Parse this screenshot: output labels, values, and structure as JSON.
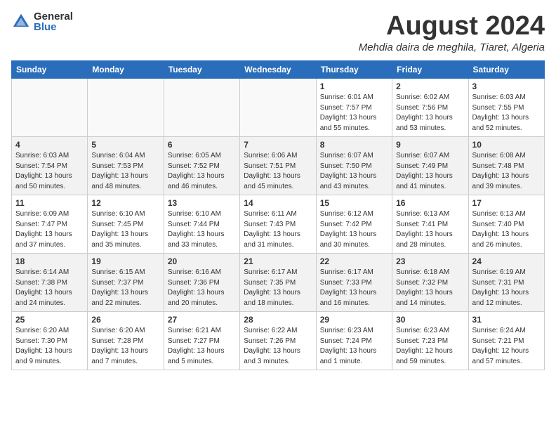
{
  "header": {
    "logo_general": "General",
    "logo_blue": "Blue",
    "month_title": "August 2024",
    "location": "Mehdia daira de meghila, Tiaret, Algeria"
  },
  "weekdays": [
    "Sunday",
    "Monday",
    "Tuesday",
    "Wednesday",
    "Thursday",
    "Friday",
    "Saturday"
  ],
  "weeks": [
    [
      {
        "day": "",
        "info": ""
      },
      {
        "day": "",
        "info": ""
      },
      {
        "day": "",
        "info": ""
      },
      {
        "day": "",
        "info": ""
      },
      {
        "day": "1",
        "info": "Sunrise: 6:01 AM\nSunset: 7:57 PM\nDaylight: 13 hours\nand 55 minutes."
      },
      {
        "day": "2",
        "info": "Sunrise: 6:02 AM\nSunset: 7:56 PM\nDaylight: 13 hours\nand 53 minutes."
      },
      {
        "day": "3",
        "info": "Sunrise: 6:03 AM\nSunset: 7:55 PM\nDaylight: 13 hours\nand 52 minutes."
      }
    ],
    [
      {
        "day": "4",
        "info": "Sunrise: 6:03 AM\nSunset: 7:54 PM\nDaylight: 13 hours\nand 50 minutes."
      },
      {
        "day": "5",
        "info": "Sunrise: 6:04 AM\nSunset: 7:53 PM\nDaylight: 13 hours\nand 48 minutes."
      },
      {
        "day": "6",
        "info": "Sunrise: 6:05 AM\nSunset: 7:52 PM\nDaylight: 13 hours\nand 46 minutes."
      },
      {
        "day": "7",
        "info": "Sunrise: 6:06 AM\nSunset: 7:51 PM\nDaylight: 13 hours\nand 45 minutes."
      },
      {
        "day": "8",
        "info": "Sunrise: 6:07 AM\nSunset: 7:50 PM\nDaylight: 13 hours\nand 43 minutes."
      },
      {
        "day": "9",
        "info": "Sunrise: 6:07 AM\nSunset: 7:49 PM\nDaylight: 13 hours\nand 41 minutes."
      },
      {
        "day": "10",
        "info": "Sunrise: 6:08 AM\nSunset: 7:48 PM\nDaylight: 13 hours\nand 39 minutes."
      }
    ],
    [
      {
        "day": "11",
        "info": "Sunrise: 6:09 AM\nSunset: 7:47 PM\nDaylight: 13 hours\nand 37 minutes."
      },
      {
        "day": "12",
        "info": "Sunrise: 6:10 AM\nSunset: 7:45 PM\nDaylight: 13 hours\nand 35 minutes."
      },
      {
        "day": "13",
        "info": "Sunrise: 6:10 AM\nSunset: 7:44 PM\nDaylight: 13 hours\nand 33 minutes."
      },
      {
        "day": "14",
        "info": "Sunrise: 6:11 AM\nSunset: 7:43 PM\nDaylight: 13 hours\nand 31 minutes."
      },
      {
        "day": "15",
        "info": "Sunrise: 6:12 AM\nSunset: 7:42 PM\nDaylight: 13 hours\nand 30 minutes."
      },
      {
        "day": "16",
        "info": "Sunrise: 6:13 AM\nSunset: 7:41 PM\nDaylight: 13 hours\nand 28 minutes."
      },
      {
        "day": "17",
        "info": "Sunrise: 6:13 AM\nSunset: 7:40 PM\nDaylight: 13 hours\nand 26 minutes."
      }
    ],
    [
      {
        "day": "18",
        "info": "Sunrise: 6:14 AM\nSunset: 7:38 PM\nDaylight: 13 hours\nand 24 minutes."
      },
      {
        "day": "19",
        "info": "Sunrise: 6:15 AM\nSunset: 7:37 PM\nDaylight: 13 hours\nand 22 minutes."
      },
      {
        "day": "20",
        "info": "Sunrise: 6:16 AM\nSunset: 7:36 PM\nDaylight: 13 hours\nand 20 minutes."
      },
      {
        "day": "21",
        "info": "Sunrise: 6:17 AM\nSunset: 7:35 PM\nDaylight: 13 hours\nand 18 minutes."
      },
      {
        "day": "22",
        "info": "Sunrise: 6:17 AM\nSunset: 7:33 PM\nDaylight: 13 hours\nand 16 minutes."
      },
      {
        "day": "23",
        "info": "Sunrise: 6:18 AM\nSunset: 7:32 PM\nDaylight: 13 hours\nand 14 minutes."
      },
      {
        "day": "24",
        "info": "Sunrise: 6:19 AM\nSunset: 7:31 PM\nDaylight: 13 hours\nand 12 minutes."
      }
    ],
    [
      {
        "day": "25",
        "info": "Sunrise: 6:20 AM\nSunset: 7:30 PM\nDaylight: 13 hours\nand 9 minutes."
      },
      {
        "day": "26",
        "info": "Sunrise: 6:20 AM\nSunset: 7:28 PM\nDaylight: 13 hours\nand 7 minutes."
      },
      {
        "day": "27",
        "info": "Sunrise: 6:21 AM\nSunset: 7:27 PM\nDaylight: 13 hours\nand 5 minutes."
      },
      {
        "day": "28",
        "info": "Sunrise: 6:22 AM\nSunset: 7:26 PM\nDaylight: 13 hours\nand 3 minutes."
      },
      {
        "day": "29",
        "info": "Sunrise: 6:23 AM\nSunset: 7:24 PM\nDaylight: 13 hours\nand 1 minute."
      },
      {
        "day": "30",
        "info": "Sunrise: 6:23 AM\nSunset: 7:23 PM\nDaylight: 12 hours\nand 59 minutes."
      },
      {
        "day": "31",
        "info": "Sunrise: 6:24 AM\nSunset: 7:21 PM\nDaylight: 12 hours\nand 57 minutes."
      }
    ]
  ]
}
